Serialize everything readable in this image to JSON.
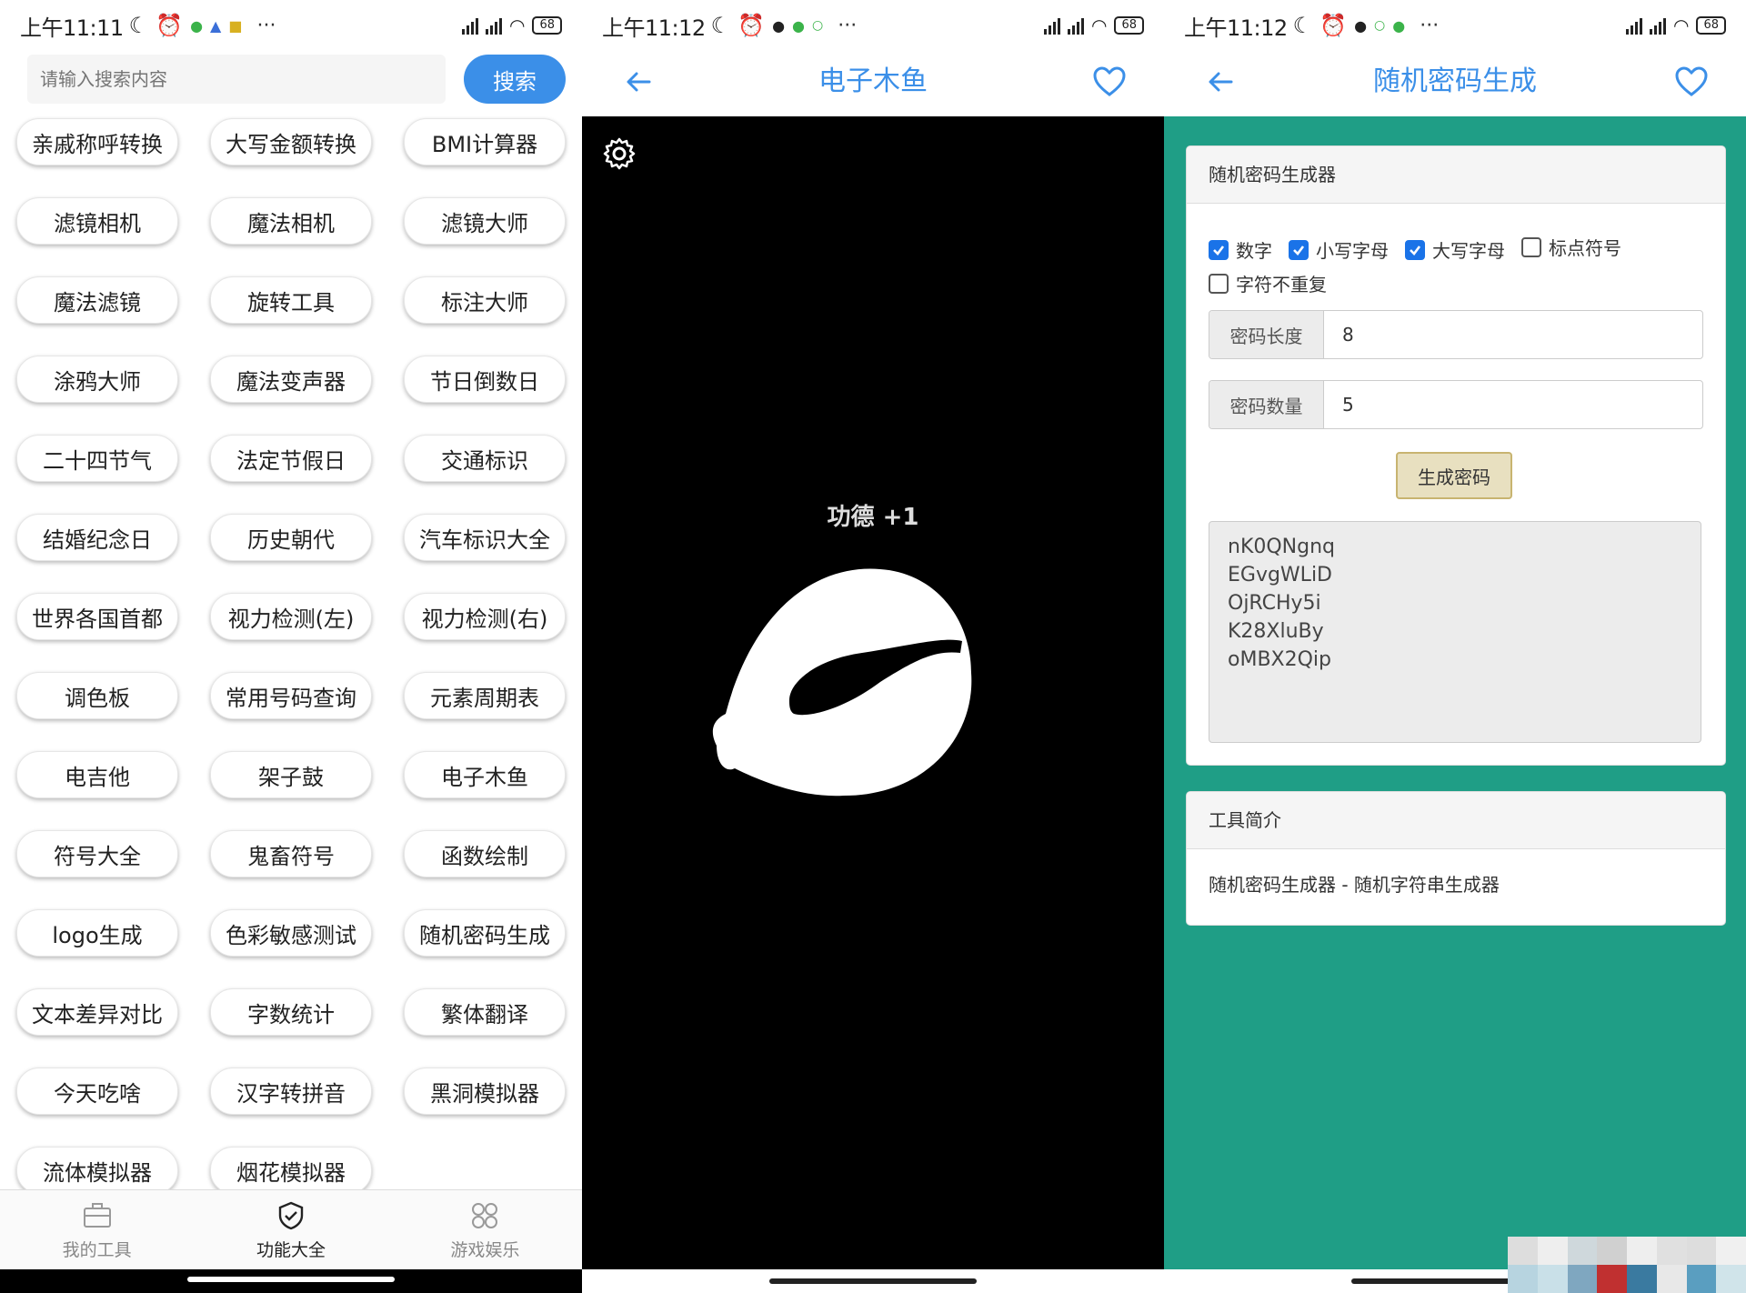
{
  "screen1": {
    "status": {
      "time": "上午11:11",
      "battery": "68"
    },
    "search": {
      "placeholder": "请输入搜索内容",
      "button": "搜索"
    },
    "tools": [
      "亲戚称呼转换",
      "大写金额转换",
      "BMI计算器",
      "滤镜相机",
      "魔法相机",
      "滤镜大师",
      "魔法滤镜",
      "旋转工具",
      "标注大师",
      "涂鸦大师",
      "魔法变声器",
      "节日倒数日",
      "二十四节气",
      "法定节假日",
      "交通标识",
      "结婚纪念日",
      "历史朝代",
      "汽车标识大全",
      "世界各国首都",
      "视力检测(左)",
      "视力检测(右)",
      "调色板",
      "常用号码查询",
      "元素周期表",
      "电吉他",
      "架子鼓",
      "电子木鱼",
      "符号大全",
      "鬼畜符号",
      "函数绘制",
      "logo生成",
      "色彩敏感测试",
      "随机密码生成",
      "文本差异对比",
      "字数统计",
      "繁体翻译",
      "今天吃啥",
      "汉字转拼音",
      "黑洞模拟器",
      "流体模拟器",
      "烟花模拟器"
    ],
    "nav": [
      {
        "label": "我的工具",
        "icon": "briefcase-icon",
        "active": false
      },
      {
        "label": "功能大全",
        "icon": "shield-check-icon",
        "active": true
      },
      {
        "label": "游戏娱乐",
        "icon": "grid-apps-icon",
        "active": false
      }
    ]
  },
  "screen2": {
    "status": {
      "time": "上午11:12",
      "battery": "68"
    },
    "title": "电子木鱼",
    "merit_text": "功德 +1"
  },
  "screen3": {
    "status": {
      "time": "上午11:12",
      "battery": "68"
    },
    "title": "随机密码生成",
    "card_title": "随机密码生成器",
    "options": [
      {
        "label": "数字",
        "checked": true
      },
      {
        "label": "小写字母",
        "checked": true
      },
      {
        "label": "大写字母",
        "checked": true
      },
      {
        "label": "标点符号",
        "checked": false
      },
      {
        "label": "字符不重复",
        "checked": false
      }
    ],
    "length_label": "密码长度",
    "length_value": "8",
    "count_label": "密码数量",
    "count_value": "5",
    "generate_button": "生成密码",
    "passwords": [
      "nK0QNgnq",
      "EGvgWLiD",
      "OjRCHy5i",
      "K28XluBy",
      "oMBX2Qip"
    ],
    "intro_title": "工具简介",
    "intro_text": "随机密码生成器 - 随机字符串生成器"
  },
  "colors": {
    "accent": "#3b8fe8",
    "teal": "#1f9e86",
    "checkbox": "#1a73e8"
  }
}
